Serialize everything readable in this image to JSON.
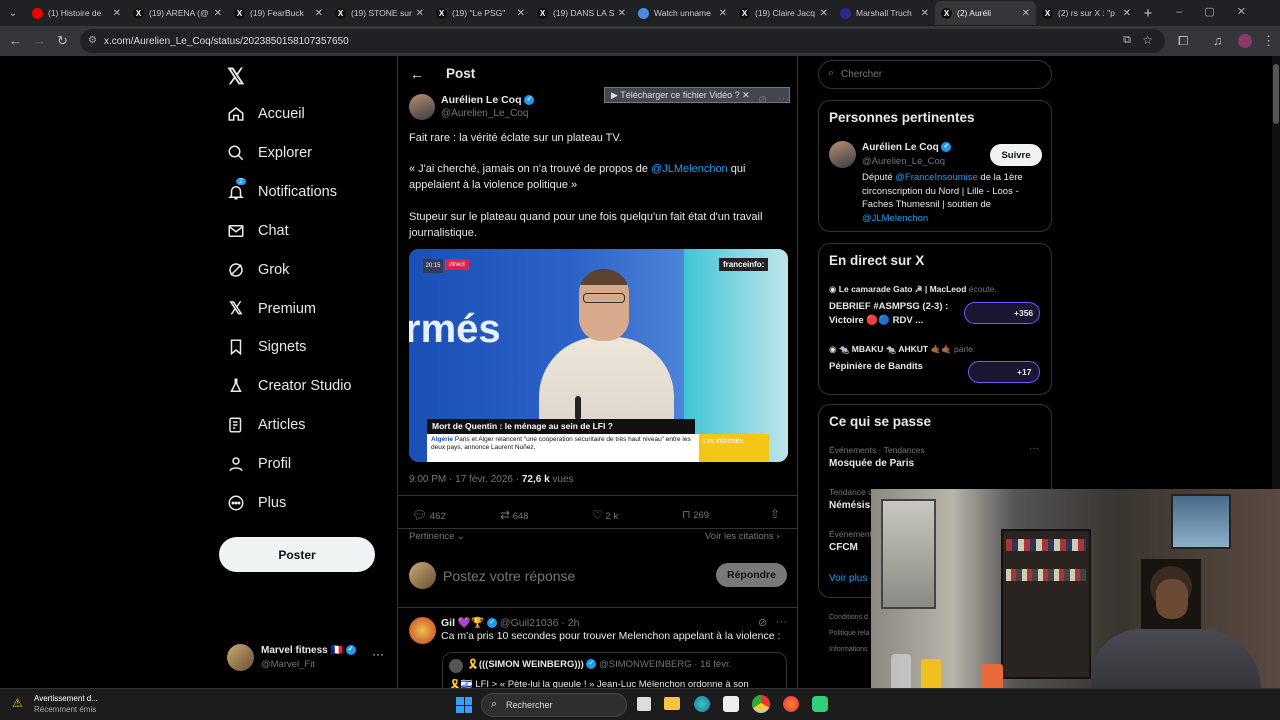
{
  "browser": {
    "tabs": [
      {
        "title": "(1) Histoire de",
        "color": "#e00"
      },
      {
        "title": "(19) ARENA (@",
        "color": "#111"
      },
      {
        "title": "(19) FearBuck",
        "color": "#111"
      },
      {
        "title": "(19) STONE sur",
        "color": "#111"
      },
      {
        "title": "(19) \"Le PSG\"",
        "color": "#111"
      },
      {
        "title": "(19) DANS LA S",
        "color": "#111"
      },
      {
        "title": "Watch unname",
        "color": "#4a8de0"
      },
      {
        "title": "(19) Claire Jacq",
        "color": "#111"
      },
      {
        "title": "Marshall Truch",
        "color": "#2a2a8a"
      },
      {
        "title": "(2) Auréli",
        "color": "#111",
        "active": true
      },
      {
        "title": "(2) rs sur X : \"p",
        "color": "#111"
      }
    ],
    "url": "x.com/Aurelien_Le_Coq/status/2023850158107357650"
  },
  "nav": {
    "items": [
      {
        "label": "Accueil",
        "icon": "home-icon"
      },
      {
        "label": "Explorer",
        "icon": "search-icon"
      },
      {
        "label": "Notifications",
        "icon": "bell-icon",
        "badge": "2"
      },
      {
        "label": "Chat",
        "icon": "mail-icon"
      },
      {
        "label": "Grok",
        "icon": "grok-icon"
      },
      {
        "label": "Premium",
        "icon": "x-logo-icon"
      },
      {
        "label": "Signets",
        "icon": "bookmark-icon"
      },
      {
        "label": "Creator Studio",
        "icon": "flask-icon"
      },
      {
        "label": "Articles",
        "icon": "article-icon"
      },
      {
        "label": "Profil",
        "icon": "person-icon"
      },
      {
        "label": "Plus",
        "icon": "more-circle-icon"
      }
    ],
    "post_button": "Poster",
    "account": {
      "name": "Marvel fitness 🇫🇷",
      "handle": "@Marvel_Fit"
    }
  },
  "post": {
    "header": "Post",
    "author": {
      "name": "Aurélien Le Coq",
      "handle": "@Aurelien_Le_Coq"
    },
    "download_overlay": "Télécharger ce fichier Vidéo",
    "text1": "Fait rare :  la vérité éclate sur un plateau TV.",
    "text2_pre": "« J'ai cherché, jamais on n'a trouvé de propos de ",
    "text2_mention": "@JLMelenchon",
    "text2_post": " qui appelaient à la violence politique »",
    "text3": "Stupeur sur le plateau quand pour une fois quelqu'un fait état d'un travail journalistique.",
    "video": {
      "live_badge": "direct",
      "channel": "franceinfo:",
      "bg_word": "rmés",
      "headline": "Mort de Quentin : le ménage au sein de LFI ?",
      "ticker_label": "Algérie",
      "ticker_text": "Paris et Alger relancent \"une coopération sécuritaire de très haut niveau\" entre les deux pays, annonce Laurent Nuñez.",
      "show_tag": "Les informés"
    },
    "time": "9:00 PM · 17 févr. 2026 · ",
    "views": "72,6 k",
    "views_label": " vues",
    "stats": {
      "replies": "462",
      "reposts": "648",
      "likes": "2 k",
      "bookmarks": "269"
    },
    "sort_label": "Pertinence",
    "quotes_label": "Voir les citations",
    "reply_placeholder": "Postez votre réponse",
    "reply_button": "Répondre",
    "reply": {
      "name": "Gil 💜🏆",
      "handle": "@Guil21036 · 2h",
      "text": "Ca m'a pris 10 secondes pour trouver Melenchon appelant à la violence :",
      "quote_name": "🎗️(((SIMON WEINBERG)))",
      "quote_handle": "@SIMONWEINBERG · 16 févr.",
      "quote_text": "🎗️🇮🇱 LFI > « Pète-lui la gueule ! » Jean-Luc Mélenchon ordonne à son"
    }
  },
  "right": {
    "search_placeholder": "Chercher",
    "relevant": {
      "title": "Personnes pertinentes",
      "name": "Aurélien Le Coq",
      "handle": "@Aurelien_Le_Coq",
      "follow": "Suivre",
      "bio_pre": "Député ",
      "bio_mention1": "@FranceInsoumise",
      "bio_mid": " de la 1ère circonscription du Nord | Lille - Loos - Faches Thumesnil | soutien de ",
      "bio_mention2": "@JLMelenchon"
    },
    "live": {
      "title": "En direct sur X",
      "space1_host": "Le camarade Gato ☭ | MacLeod",
      "space1_action": " écoute.",
      "space1_title": "DEBRIEF #ASMPSG (2-3) : Victoire 🔴🔵 RDV ...",
      "space1_count": "+356",
      "space2_host": "🐀 MBAKU 🐀 AHKUT 🤙🏾🤙🏾",
      "space2_action": " parle.",
      "space2_title": "Pépinière de Bandits",
      "space2_count": "+17"
    },
    "trending": {
      "title": "Ce qui se passe",
      "item1_meta": "Événements · Tendances",
      "item1_title": "Mosquée de Paris",
      "item2_meta": "Tendance dans la catégorie France",
      "item2_title": "Némésis",
      "item3_meta": "Événements",
      "item3_title": "CFCM",
      "show_more": "Voir plus"
    },
    "footer": [
      "Conditions d",
      "Politique rela",
      "Informations"
    ]
  },
  "taskbar": {
    "notif_title": "Avertissement d...",
    "notif_sub": "Récemment émis",
    "search": "Rechercher"
  },
  "colors": {
    "accent": "#1d9bf0",
    "border": "#2f3336",
    "muted": "#71767b"
  }
}
